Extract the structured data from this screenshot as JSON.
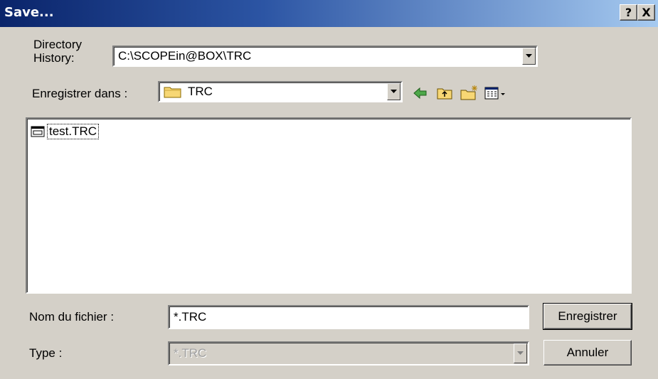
{
  "window": {
    "title": "Save...",
    "help_label": "?",
    "close_label": "X"
  },
  "directory_history": {
    "label_line1": "Directory",
    "label_line2": "History:",
    "value": "C:\\SCOPEin@BOX\\TRC"
  },
  "save_in": {
    "label": "Enregistrer dans :",
    "folder": "TRC",
    "toolbar": [
      "back-icon",
      "up-folder-icon",
      "new-folder-icon",
      "view-menu-icon"
    ]
  },
  "files": [
    {
      "name": "test.TRC",
      "icon": "trc-file-icon"
    }
  ],
  "filename": {
    "label": "Nom du fichier :",
    "value": "*.TRC"
  },
  "type": {
    "label": "Type :",
    "value": "*.TRC"
  },
  "buttons": {
    "save": "Enregistrer",
    "cancel": "Annuler"
  },
  "colors": {
    "titlebar_start": "#0a246a",
    "titlebar_end": "#a6caf0",
    "face": "#d4d0c8"
  }
}
